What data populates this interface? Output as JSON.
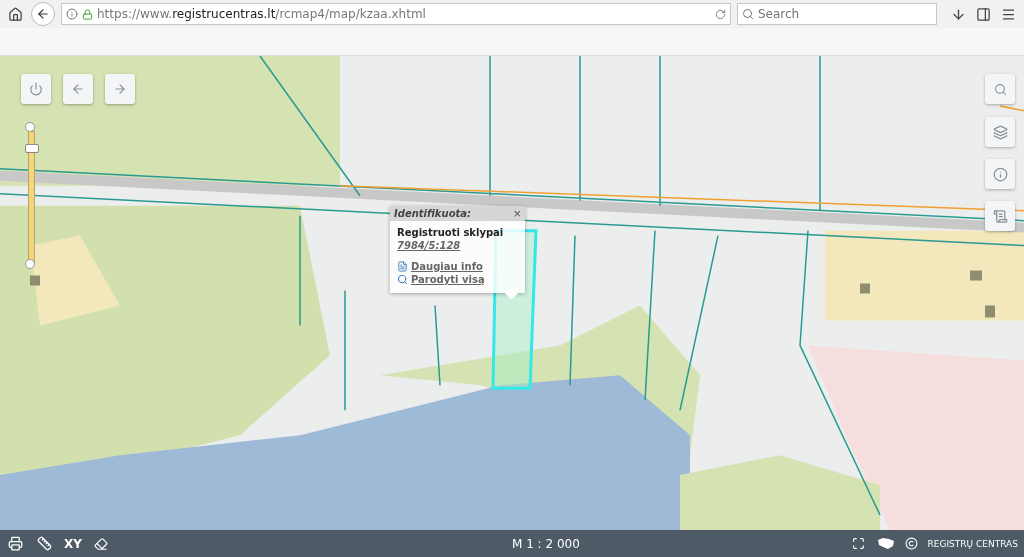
{
  "browser": {
    "url_prefix": "https://www.",
    "url_domain": "registrucentras.lt",
    "url_path": "/rcmap4/map/kzaa.xhtml",
    "search": {
      "placeholder": "Search"
    }
  },
  "map": {
    "kind": "picture",
    "zoom": {
      "level": 0.9
    },
    "popup": {
      "title": "Identifikuota:",
      "close": "×",
      "heading": "Registruoti sklypai",
      "parcel": "7984/5:128",
      "links": [
        {
          "label": "Daugiau info",
          "kind": "info"
        },
        {
          "label": "Parodyti visą",
          "kind": "zoom"
        }
      ]
    }
  },
  "status_bar": {
    "xy": "XY",
    "scale": "M 1 : 2 000",
    "brand": "REGISTRŲ CENTRAS"
  }
}
